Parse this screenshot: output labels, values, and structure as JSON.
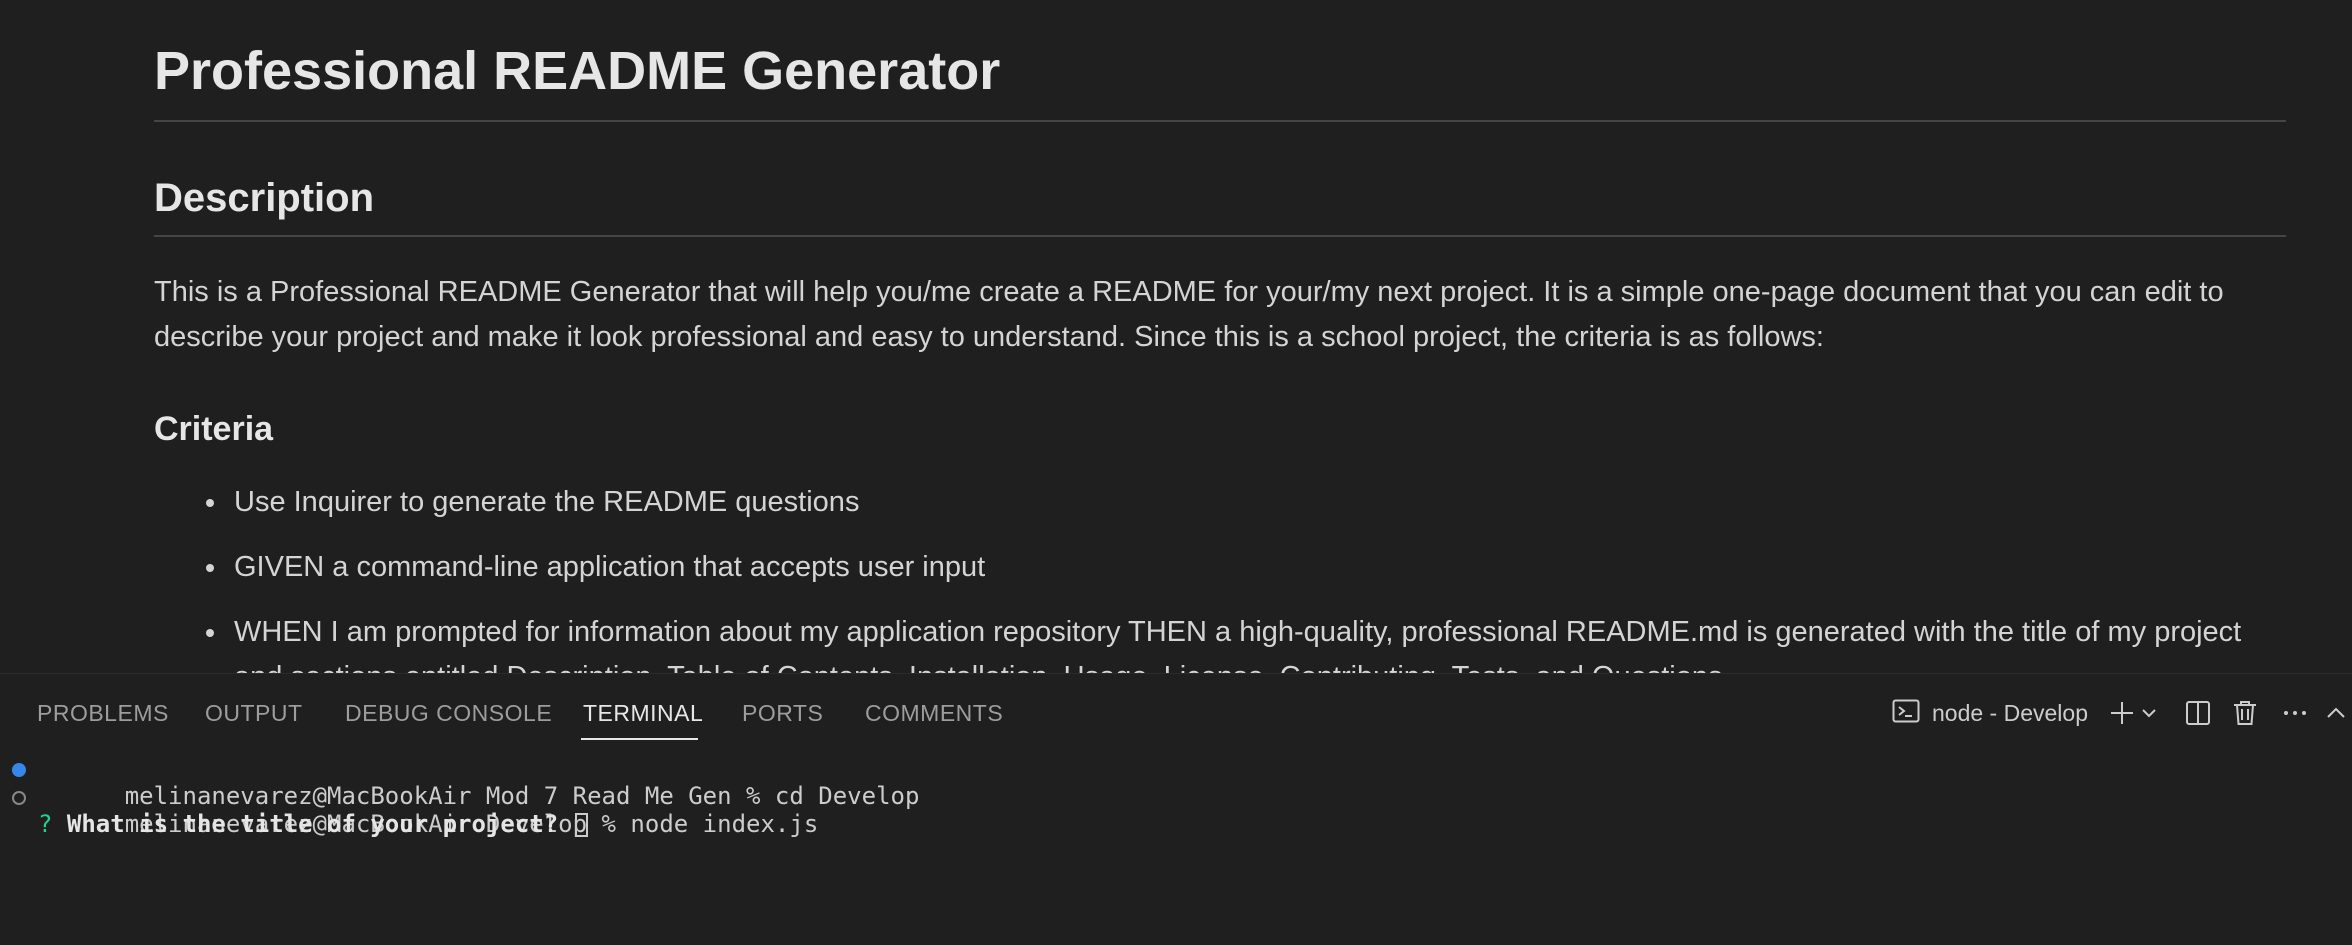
{
  "preview": {
    "title": "Professional README Generator",
    "description_heading": "Description",
    "description_text": "This is a Professional README Generator that will help you/me create a README for your/my next project. It is a simple one-page document that you can edit to describe your project and make it look professional and easy to understand. Since this is a school project, the criteria is as follows:",
    "criteria_heading": "Criteria",
    "criteria": [
      "Use Inquirer to generate the README questions",
      "GIVEN a command-line application that accepts user input",
      "WHEN I am prompted for information about my application repository THEN a high-quality, professional README.md is generated with the title of my project and sections entitled Description, Table of Contents, Installation, Usage, License, Contributing, Tests, and Questions"
    ]
  },
  "panel": {
    "tabs": [
      "PROBLEMS",
      "OUTPUT",
      "DEBUG CONSOLE",
      "TERMINAL",
      "PORTS",
      "COMMENTS"
    ],
    "active_tab": "TERMINAL",
    "terminal_name": "node - Develop",
    "icons": [
      "terminal-icon",
      "plus-icon",
      "chevron-down-icon",
      "split-icon",
      "trash-icon",
      "ellipsis-icon",
      "chevron-up-icon"
    ]
  },
  "terminal": {
    "lines": [
      {
        "status": "success",
        "text": "melinanevarez@MacBookAir Mod 7 Read Me Gen % cd Develop"
      },
      {
        "status": "default",
        "text": "melinanevarez@MacBookAir Develop % node index.js"
      }
    ],
    "prompt_mark": "?",
    "prompt_text": "What is the title of your project?"
  },
  "colors": {
    "background": "#1f1f1f",
    "accent_blue": "#3794ff",
    "prompt_green": "#23d18b"
  }
}
